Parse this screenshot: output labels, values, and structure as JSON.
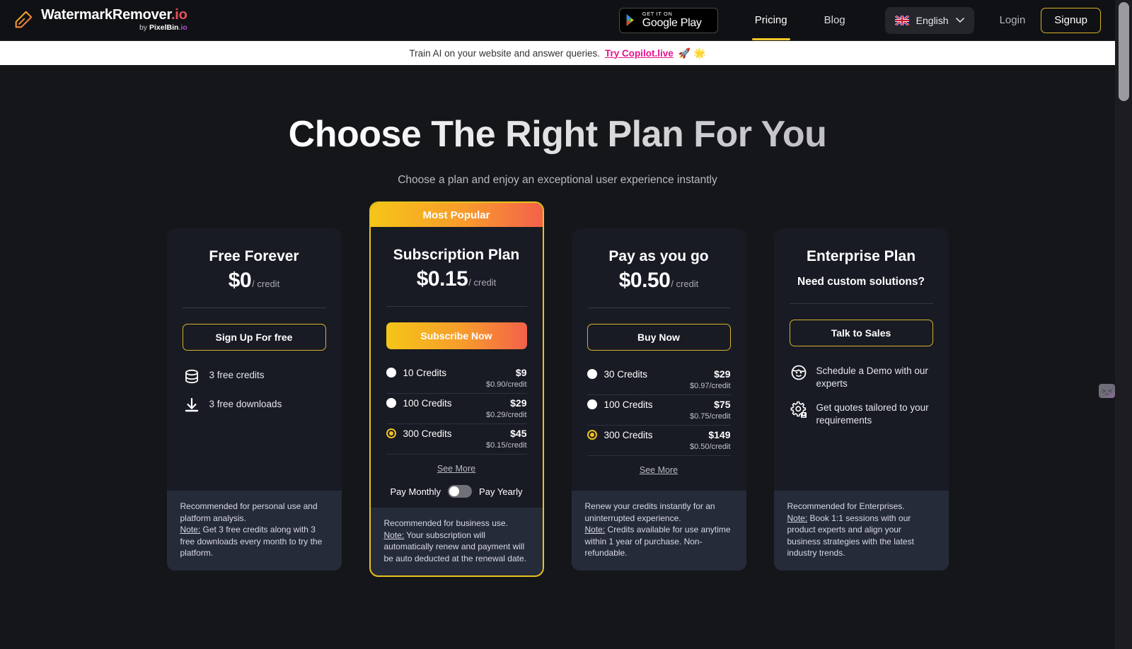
{
  "header": {
    "brand_name": "WatermarkRemover",
    "brand_tld": ".io",
    "brand_by": "by ",
    "brand_parent": "PixelBin",
    "brand_parent_tld": ".io",
    "google_play_small": "GET IT ON",
    "google_play_big": "Google Play",
    "nav": [
      {
        "label": "Pricing",
        "active": true
      },
      {
        "label": "Blog",
        "active": false
      }
    ],
    "language": "English",
    "login": "Login",
    "signup": "Signup"
  },
  "announcement": {
    "text": "Train AI on your website and answer queries.",
    "link": "Try Copilot.live",
    "emoji": "🚀 🌟"
  },
  "hero": {
    "title": "Choose The Right Plan For You",
    "subtitle": "Choose a plan and enjoy an exceptional user experience instantly"
  },
  "cards": {
    "free": {
      "title": "Free Forever",
      "price": "$0",
      "per": "/ credit",
      "cta": "Sign Up For free",
      "features": [
        {
          "icon": "database-icon",
          "text": "3 free credits"
        },
        {
          "icon": "download-icon",
          "text": "3 free downloads"
        }
      ],
      "note_line1": "Recommended for personal use and platform analysis.",
      "note_label": "Note:",
      "note_line2": " Get 3 free credits along with 3 free downloads every month to try the platform."
    },
    "subscription": {
      "ribbon": "Most Popular",
      "title": "Subscription Plan",
      "price": "$0.15",
      "per": "/ credit",
      "cta": "Subscribe Now",
      "options": [
        {
          "label": "10 Credits",
          "price": "$9",
          "unit": "$0.90/credit",
          "selected": false
        },
        {
          "label": "100 Credits",
          "price": "$29",
          "unit": "$0.29/credit",
          "selected": false
        },
        {
          "label": "300 Credits",
          "price": "$45",
          "unit": "$0.15/credit",
          "selected": true
        }
      ],
      "see_more": "See More",
      "toggle_left": "Pay Monthly",
      "toggle_right": "Pay Yearly",
      "toggle_state": "monthly",
      "note_line1": "Recommended for business use.",
      "note_label": "Note:",
      "note_line2": " Your subscription will automatically renew and payment will be auto deducted at the renewal date."
    },
    "payg": {
      "title": "Pay as you go",
      "price": "$0.50",
      "per": "/ credit",
      "cta": "Buy Now",
      "options": [
        {
          "label": "30 Credits",
          "price": "$29",
          "unit": "$0.97/credit",
          "selected": false
        },
        {
          "label": "100 Credits",
          "price": "$75",
          "unit": "$0.75/credit",
          "selected": false
        },
        {
          "label": "300 Credits",
          "price": "$149",
          "unit": "$0.50/credit",
          "selected": true
        }
      ],
      "see_more": "See More",
      "note_line1": "Renew your credits instantly for an uninterrupted experience.",
      "note_label": "Note:",
      "note_line2": " Credits available for use anytime within 1 year of purchase. Non-refundable."
    },
    "enterprise": {
      "title": "Enterprise Plan",
      "subtitle": "Need custom solutions?",
      "cta": "Talk to Sales",
      "features": [
        {
          "icon": "smiley-face-icon",
          "text": "Schedule a Demo with our experts"
        },
        {
          "icon": "gear-person-icon",
          "text": "Get quotes tailored to your requirements"
        }
      ],
      "note_line1": "Recommended for Enterprises.",
      "note_label": "Note:",
      "note_line2": " Book 1:1 sessions with our product experts and align your business strategies with the latest industry trends."
    }
  },
  "side_tab": {
    "label": ">_<"
  },
  "colors": {
    "accent_yellow": "#f0c21e",
    "gradient_start": "#f5c518",
    "gradient_mid": "#f79b2c",
    "gradient_end": "#f4614a",
    "page_bg": "#15161a",
    "card_bg": "#181b24",
    "note_bg": "#262b3a",
    "announce_link": "#e8118b"
  }
}
